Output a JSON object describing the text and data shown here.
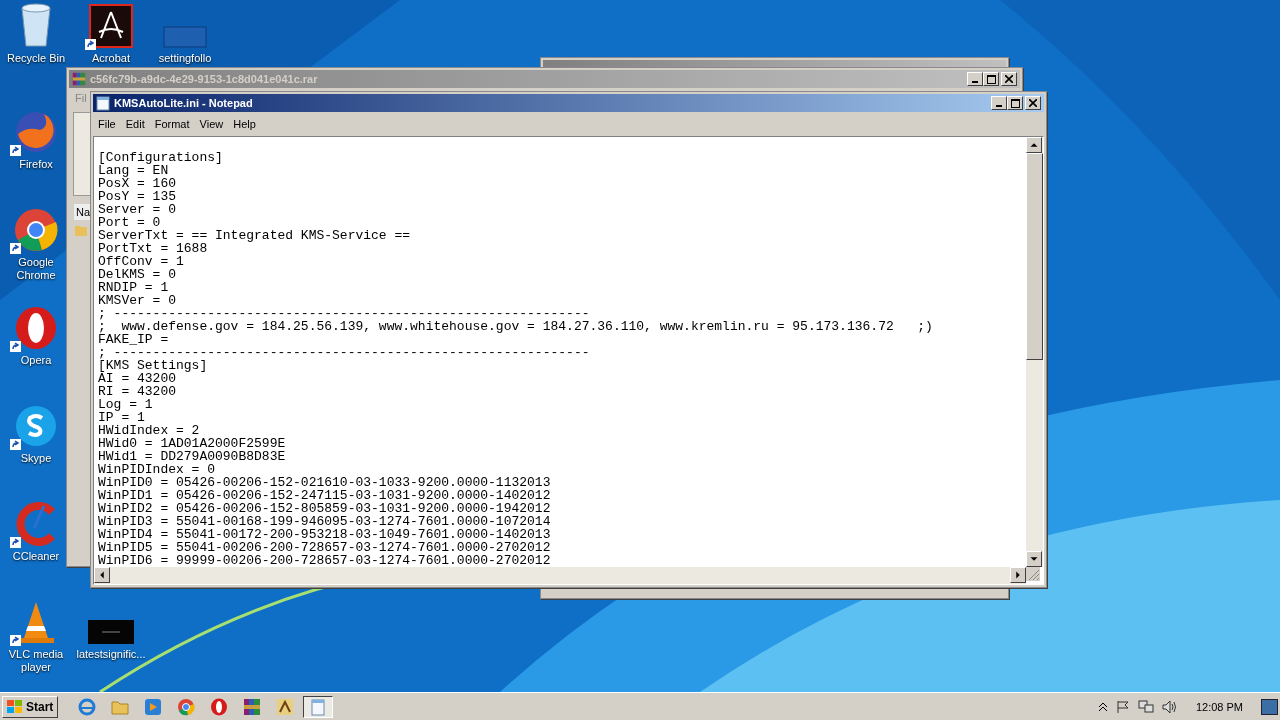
{
  "desktop": {
    "icons": [
      {
        "kind": "recycle",
        "label": "Recycle Bin"
      },
      {
        "kind": "acrobat",
        "label": "Acrobat"
      },
      {
        "kind": "folder",
        "label": "settingfollo"
      },
      {
        "kind": "firefox",
        "label": "Firefox"
      },
      {
        "kind": "chrome",
        "label": "Google Chrome"
      },
      {
        "kind": "opera",
        "label": "Opera"
      },
      {
        "kind": "skype",
        "label": "Skype"
      },
      {
        "kind": "ccleaner",
        "label": "CCleaner"
      },
      {
        "kind": "vlc",
        "label": "VLC media player"
      },
      {
        "kind": "blackfile",
        "label": "latestsignific..."
      }
    ]
  },
  "background_window": {
    "kind": "window"
  },
  "archive_window": {
    "title": "c56fc79b-a9dc-4e29-9153-1c8d041e041c.rar",
    "menu": "Fil",
    "column": "Na"
  },
  "notepad": {
    "title": "KMSAutoLite.ini - Notepad",
    "menu": [
      "File",
      "Edit",
      "Format",
      "View",
      "Help"
    ],
    "lines": [
      "[Configurations]",
      "Lang = EN",
      "PosX = 160",
      "PosY = 135",
      "Server = 0",
      "Port = 0",
      "ServerTxt = == Integrated KMS-Service ==",
      "PortTxt = 1688",
      "OffConv = 1",
      "DelKMS = 0",
      "RNDIP = 1",
      "KMSVer = 0",
      "; -------------------------------------------------------------",
      ";  www.defense.gov = 184.25.56.139, www.whitehouse.gov = 184.27.36.110, www.kremlin.ru = 95.173.136.72   ;)",
      "FAKE_IP =",
      "; -------------------------------------------------------------",
      "[KMS Settings]",
      "AI = 43200",
      "RI = 43200",
      "Log = 1",
      "IP = 1",
      "HWidIndex = 2",
      "HWid0 = 1AD01A2000F2599E",
      "HWid1 = DD279A0090B8D83E",
      "WinPIDIndex = 0",
      "WinPID0 = 05426-00206-152-021610-03-1033-9200.0000-1132013",
      "WinPID1 = 05426-00206-152-247115-03-1031-9200.0000-1402012",
      "WinPID2 = 05426-00206-152-805859-03-1031-9200.0000-1942012",
      "WinPID3 = 55041-00168-199-946095-03-1274-7601.0000-1072014",
      "WinPID4 = 55041-00172-200-953218-03-1049-7601.0000-1402013",
      "WinPID5 = 55041-00206-200-728657-03-1274-7601.0000-2702012",
      "WinPID6 = 99999-00206-200-728657-03-1274-7601.0000-2702012"
    ]
  },
  "taskbar": {
    "start": "Start",
    "apps": [
      {
        "kind": "ie",
        "selected": false
      },
      {
        "kind": "explorer",
        "selected": false
      },
      {
        "kind": "media",
        "selected": false
      },
      {
        "kind": "chrome",
        "selected": false
      },
      {
        "kind": "opera",
        "selected": false
      },
      {
        "kind": "winrar",
        "selected": false
      },
      {
        "kind": "kms",
        "selected": false
      },
      {
        "kind": "notepad",
        "selected": true
      }
    ],
    "clock": "12:08 PM"
  }
}
